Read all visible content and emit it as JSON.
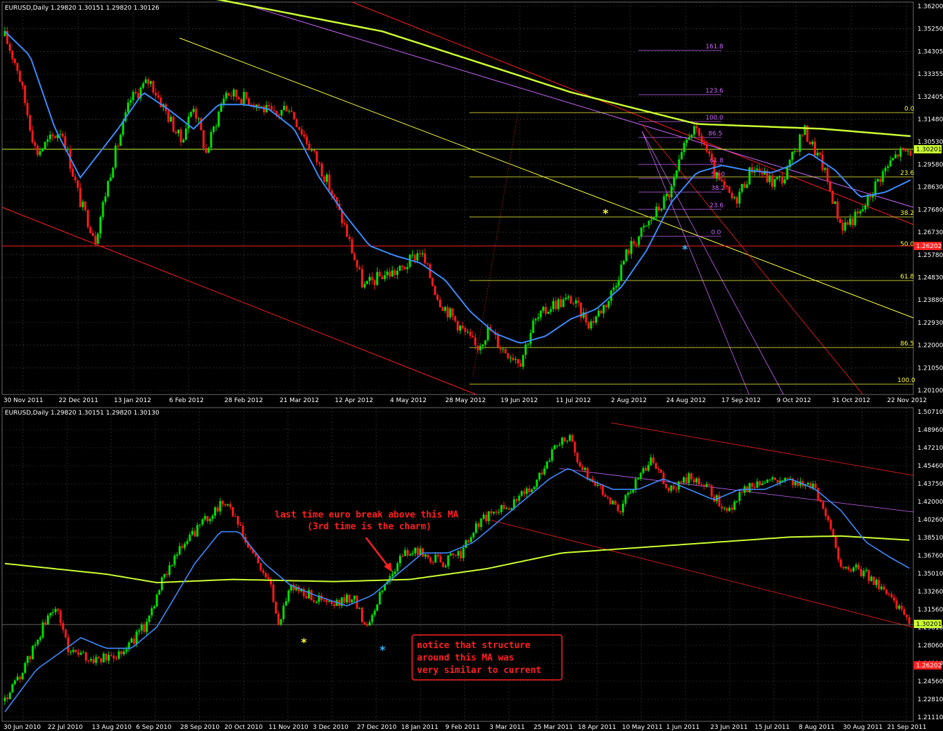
{
  "colors": {
    "bull": "#00e000",
    "bear": "#ff1a1a",
    "ma_fast": "#3c8cff",
    "ma_slow": "#ccff33",
    "grid": "#3a4a3a",
    "fib_yellow": "#ffff40",
    "fib_violet": "#cc66ff",
    "channel_red": "#ff2020",
    "price_box_green": "#ccff33",
    "price_box_red": "#ff2020"
  },
  "top": {
    "header": "EURUSD,Daily  1.29820 1.30151 1.29820 1.30126",
    "price_labels": [
      "1.36200",
      "1.35250",
      "1.34305",
      "1.33355",
      "1.32405",
      "1.31480",
      "1.30530",
      "1.29580",
      "1.28630",
      "1.27680",
      "1.26730",
      "1.25780",
      "1.24830",
      "1.23880",
      "1.22930",
      "1.22000",
      "1.21050",
      "1.20100"
    ],
    "date_labels": [
      "30 Nov 2011",
      "22 Dec 2011",
      "13 Jan 2012",
      "6 Feb 2012",
      "28 Feb 2012",
      "21 Mar 2012",
      "12 Apr 2012",
      "4 May 2012",
      "28 May 2012",
      "19 Jun 2012",
      "11 Jul 2012",
      "2 Aug 2012",
      "24 Aug 2012",
      "17 Sep 2012",
      "9 Oct 2012",
      "31 Oct 2012",
      "22 Nov 2012"
    ],
    "price_box_green": "1.30201",
    "price_box_red": "1.26202",
    "fib_yellow_levels": [
      "0.0",
      "23.6",
      "38.2",
      "50.0",
      "61.8",
      "86.5",
      "100.0"
    ],
    "fib_violet_levels": [
      "161.8",
      "123.6",
      "100.0",
      "86.5",
      "61.8",
      "50.0",
      "38.2",
      "23.6",
      "0.0"
    ],
    "marker_yellow": "*",
    "marker_blue": "*"
  },
  "bottom": {
    "header": "EURUSD,Daily  1.29820 1.30151 1.29820 1.30130",
    "price_labels": [
      "1.50710",
      "1.48960",
      "1.47210",
      "1.45460",
      "1.43750",
      "1.42000",
      "1.40260",
      "1.38510",
      "1.36760",
      "1.35010",
      "1.33260",
      "1.31560",
      "1.29810",
      "1.28060",
      "1.26310",
      "1.24560",
      "1.22810",
      "1.21110"
    ],
    "date_labels": [
      "30 Jun 2010",
      "22 Jul 2010",
      "13 Aug 2010",
      "6 Sep 2010",
      "28 Sep 2010",
      "20 Oct 2010",
      "11 Nov 2010",
      "3 Dec 2010",
      "27 Dec 2010",
      "18 Jan 2011",
      "9 Feb 2011",
      "3 Mar 2011",
      "25 Mar 2011",
      "18 Apr 2011",
      "10 May 2011",
      "1 Jun 2011",
      "23 Jun 2011",
      "15 Jul 2011",
      "8 Aug 2011",
      "30 Aug 2011",
      "21 Sep 2011"
    ],
    "price_box_green": "1.30201",
    "price_box_red": "1.26202",
    "annotation_top_line1": "last time euro break above this MA",
    "annotation_top_line2": "(3rd time is the charm)",
    "annotation_box_line1": "notice that structure",
    "annotation_box_line2": "around this MA was",
    "annotation_box_line3": "very similar to current",
    "marker_yellow": "*",
    "marker_blue": "*"
  },
  "chart_data": [
    {
      "type": "candlestick",
      "title": "EURUSD,Daily  1.29820 1.30151 1.29820 1.30126",
      "ylim": [
        1.201,
        1.362
      ],
      "x_range": [
        "30 Nov 2011",
        "22 Nov 2012"
      ],
      "grid": true,
      "anchors": [
        [
          0,
          1.348
        ],
        [
          10,
          1.335
        ],
        [
          25,
          1.3
        ],
        [
          45,
          1.31
        ],
        [
          60,
          1.28
        ],
        [
          72,
          1.265
        ],
        [
          85,
          1.295
        ],
        [
          100,
          1.322
        ],
        [
          115,
          1.33
        ],
        [
          130,
          1.315
        ],
        [
          140,
          1.305
        ],
        [
          150,
          1.32
        ],
        [
          160,
          1.3
        ],
        [
          175,
          1.325
        ],
        [
          195,
          1.322
        ],
        [
          215,
          1.315
        ],
        [
          225,
          1.32
        ],
        [
          240,
          1.305
        ],
        [
          255,
          1.29
        ],
        [
          270,
          1.27
        ],
        [
          285,
          1.245
        ],
        [
          300,
          1.25
        ],
        [
          315,
          1.252
        ],
        [
          330,
          1.26
        ],
        [
          345,
          1.24
        ],
        [
          360,
          1.23
        ],
        [
          375,
          1.22
        ],
        [
          385,
          1.228
        ],
        [
          395,
          1.22
        ],
        [
          410,
          1.215
        ],
        [
          420,
          1.23
        ],
        [
          435,
          1.238
        ],
        [
          450,
          1.24
        ],
        [
          465,
          1.23
        ],
        [
          480,
          1.24
        ],
        [
          495,
          1.26
        ],
        [
          510,
          1.27
        ],
        [
          530,
          1.285
        ],
        [
          545,
          1.31
        ],
        [
          555,
          1.305
        ],
        [
          565,
          1.29
        ],
        [
          580,
          1.28
        ],
        [
          595,
          1.295
        ],
        [
          610,
          1.288
        ],
        [
          620,
          1.29
        ],
        [
          635,
          1.31
        ],
        [
          650,
          1.295
        ],
        [
          665,
          1.27
        ],
        [
          680,
          1.275
        ],
        [
          695,
          1.29
        ],
        [
          710,
          1.3
        ],
        [
          720,
          1.301
        ]
      ],
      "ma_fast_anchors": [
        [
          0,
          1.35
        ],
        [
          20,
          1.34
        ],
        [
          40,
          1.31
        ],
        [
          60,
          1.29
        ],
        [
          75,
          1.3
        ],
        [
          90,
          1.31
        ],
        [
          110,
          1.325
        ],
        [
          130,
          1.318
        ],
        [
          150,
          1.31
        ],
        [
          170,
          1.32
        ],
        [
          190,
          1.32
        ],
        [
          210,
          1.318
        ],
        [
          230,
          1.31
        ],
        [
          250,
          1.29
        ],
        [
          270,
          1.275
        ],
        [
          290,
          1.262
        ],
        [
          310,
          1.258
        ],
        [
          330,
          1.255
        ],
        [
          350,
          1.248
        ],
        [
          370,
          1.235
        ],
        [
          390,
          1.226
        ],
        [
          410,
          1.222
        ],
        [
          430,
          1.225
        ],
        [
          450,
          1.232
        ],
        [
          470,
          1.236
        ],
        [
          490,
          1.245
        ],
        [
          510,
          1.26
        ],
        [
          530,
          1.28
        ],
        [
          550,
          1.292
        ],
        [
          570,
          1.295
        ],
        [
          590,
          1.293
        ],
        [
          610,
          1.292
        ],
        [
          625,
          1.295
        ],
        [
          640,
          1.3
        ],
        [
          660,
          1.293
        ],
        [
          680,
          1.282
        ],
        [
          700,
          1.284
        ],
        [
          720,
          1.289
        ]
      ],
      "ma_slow_anchors": [
        [
          0,
          1.37
        ],
        [
          150,
          1.365
        ],
        [
          300,
          1.35
        ],
        [
          450,
          1.325
        ],
        [
          550,
          1.312
        ],
        [
          650,
          1.31
        ],
        [
          720,
          1.307
        ]
      ],
      "horizontal_levels": [
        1.30201,
        1.26202
      ]
    },
    {
      "type": "candlestick",
      "title": "EURUSD,Daily  1.29820 1.30151 1.29820 1.30130",
      "ylim": [
        1.2111,
        1.5071
      ],
      "x_range": [
        "30 Jun 2010",
        "21 Sep 2011"
      ],
      "grid": true,
      "anchors": [
        [
          0,
          1.23
        ],
        [
          15,
          1.26
        ],
        [
          30,
          1.3
        ],
        [
          40,
          1.32
        ],
        [
          50,
          1.28
        ],
        [
          65,
          1.27
        ],
        [
          80,
          1.27
        ],
        [
          95,
          1.28
        ],
        [
          110,
          1.3
        ],
        [
          130,
          1.36
        ],
        [
          150,
          1.39
        ],
        [
          165,
          1.41
        ],
        [
          175,
          1.42
        ],
        [
          190,
          1.38
        ],
        [
          200,
          1.36
        ],
        [
          210,
          1.34
        ],
        [
          215,
          1.3
        ],
        [
          225,
          1.34
        ],
        [
          240,
          1.33
        ],
        [
          260,
          1.32
        ],
        [
          275,
          1.33
        ],
        [
          285,
          1.3
        ],
        [
          300,
          1.34
        ],
        [
          315,
          1.37
        ],
        [
          330,
          1.37
        ],
        [
          345,
          1.36
        ],
        [
          360,
          1.37
        ],
        [
          375,
          1.4
        ],
        [
          390,
          1.41
        ],
        [
          405,
          1.42
        ],
        [
          420,
          1.44
        ],
        [
          435,
          1.47
        ],
        [
          445,
          1.48
        ],
        [
          455,
          1.45
        ],
        [
          470,
          1.43
        ],
        [
          485,
          1.41
        ],
        [
          500,
          1.44
        ],
        [
          510,
          1.46
        ],
        [
          525,
          1.43
        ],
        [
          540,
          1.44
        ],
        [
          555,
          1.43
        ],
        [
          570,
          1.41
        ],
        [
          585,
          1.43
        ],
        [
          600,
          1.44
        ],
        [
          620,
          1.44
        ],
        [
          640,
          1.43
        ],
        [
          650,
          1.4
        ],
        [
          660,
          1.36
        ],
        [
          680,
          1.35
        ],
        [
          700,
          1.33
        ],
        [
          715,
          1.3
        ]
      ],
      "ma_fast_anchors": [
        [
          0,
          1.22
        ],
        [
          25,
          1.26
        ],
        [
          60,
          1.29
        ],
        [
          80,
          1.28
        ],
        [
          100,
          1.28
        ],
        [
          120,
          1.3
        ],
        [
          150,
          1.36
        ],
        [
          170,
          1.39
        ],
        [
          185,
          1.39
        ],
        [
          205,
          1.36
        ],
        [
          225,
          1.34
        ],
        [
          245,
          1.33
        ],
        [
          270,
          1.32
        ],
        [
          290,
          1.33
        ],
        [
          310,
          1.35
        ],
        [
          330,
          1.37
        ],
        [
          350,
          1.37
        ],
        [
          370,
          1.38
        ],
        [
          390,
          1.4
        ],
        [
          410,
          1.42
        ],
        [
          430,
          1.44
        ],
        [
          445,
          1.45
        ],
        [
          460,
          1.44
        ],
        [
          480,
          1.43
        ],
        [
          500,
          1.43
        ],
        [
          520,
          1.44
        ],
        [
          540,
          1.43
        ],
        [
          560,
          1.42
        ],
        [
          580,
          1.43
        ],
        [
          600,
          1.43
        ],
        [
          620,
          1.44
        ],
        [
          640,
          1.43
        ],
        [
          660,
          1.41
        ],
        [
          680,
          1.38
        ],
        [
          700,
          1.365
        ],
        [
          715,
          1.355
        ]
      ],
      "ma_slow_anchors": [
        [
          0,
          1.36
        ],
        [
          80,
          1.35
        ],
        [
          120,
          1.342
        ],
        [
          180,
          1.345
        ],
        [
          260,
          1.343
        ],
        [
          320,
          1.345
        ],
        [
          380,
          1.355
        ],
        [
          440,
          1.37
        ],
        [
          500,
          1.375
        ],
        [
          560,
          1.38
        ],
        [
          620,
          1.385
        ],
        [
          660,
          1.386
        ],
        [
          715,
          1.382
        ]
      ],
      "horizontal_levels": [
        1.30201
      ]
    }
  ]
}
